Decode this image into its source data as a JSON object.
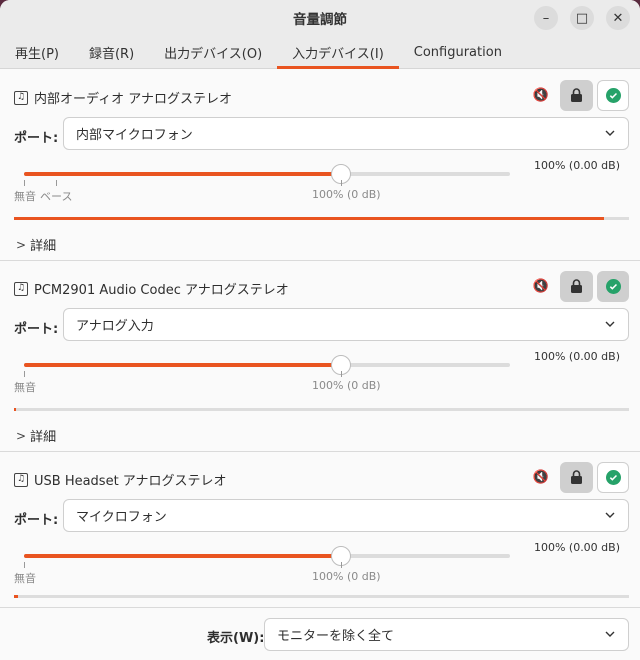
{
  "window": {
    "title": "音量調節",
    "minimize_glyph": "–",
    "maximize_glyph": "□",
    "close_glyph": "✕"
  },
  "tabs": [
    {
      "label": "再生(P)",
      "active": false
    },
    {
      "label": "録音(R)",
      "active": false
    },
    {
      "label": "出力デバイス(O)",
      "active": false
    },
    {
      "label": "入力デバイス(I)",
      "active": true
    },
    {
      "label": "Configuration",
      "active": false
    }
  ],
  "port_label": "ポート:",
  "details_label": "詳細",
  "colors": {
    "accent": "#e95420",
    "ok": "#26a269"
  },
  "devices": [
    {
      "name": "内部オーディオ アナログステレオ",
      "port": "内部マイクロフォン",
      "volume_readout": "100% (0.00 dB)",
      "slider_percent": 100,
      "ticks": [
        "無音",
        "ベース",
        "100% (0 dB)"
      ],
      "level_fraction": 0.96
    },
    {
      "name": "PCM2901 Audio Codec アナログステレオ",
      "port": "アナログ入力",
      "volume_readout": "100% (0.00 dB)",
      "slider_percent": 100,
      "ticks": [
        "無音",
        "100% (0 dB)"
      ],
      "level_fraction": 0.004
    },
    {
      "name": "USB Headset アナログステレオ",
      "port": "マイクロフォン",
      "volume_readout": "100% (0.00 dB)",
      "slider_percent": 100,
      "ticks": [
        "無音",
        "100% (0 dB)"
      ],
      "level_fraction": 0.007
    }
  ],
  "footer": {
    "label": "表示(W):",
    "value": "モニターを除く全て"
  }
}
